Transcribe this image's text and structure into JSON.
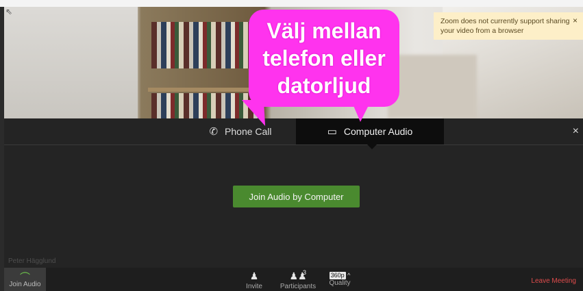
{
  "annotation": {
    "lines": [
      "Välj mellan",
      "telefon eller",
      "datorljud"
    ]
  },
  "toast": {
    "message": "Zoom does not currently support sharing your video from a browser",
    "close": "×"
  },
  "audio_panel": {
    "tabs": [
      {
        "label": "Phone Call",
        "icon": "phone-icon"
      },
      {
        "label": "Computer Audio",
        "icon": "laptop-icon"
      }
    ],
    "selected_tab": "Computer Audio",
    "close": "×",
    "join_button": "Join Audio by Computer"
  },
  "participant_name": "Peter Hägglund",
  "toolbar": {
    "join_audio": "Join Audio",
    "invite": "Invite",
    "participants": "Participants",
    "participants_count": "3",
    "quality": "Quality",
    "quality_badge": "360p",
    "leave": "Leave Meeting"
  },
  "colors": {
    "bubble": "#ff33ee",
    "join_button": "#4a8a2f",
    "leave": "#e04c4c",
    "toast": "#fdefc8"
  }
}
